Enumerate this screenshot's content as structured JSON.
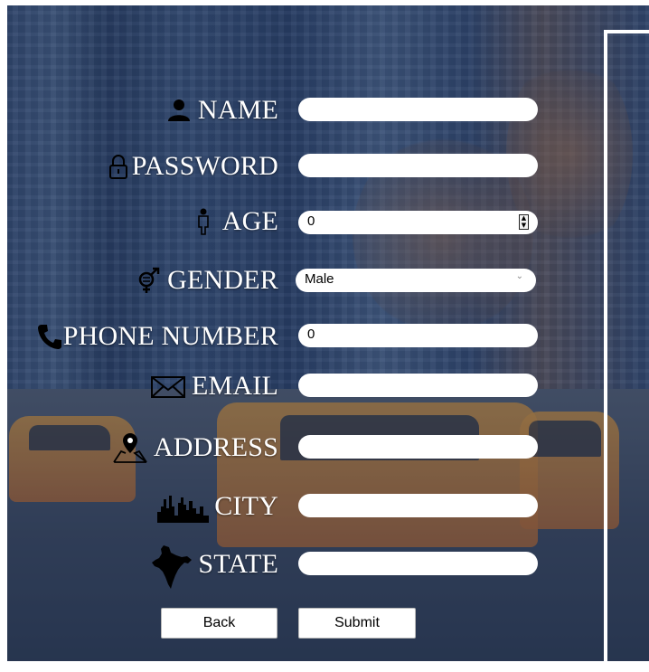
{
  "form": {
    "name_label": "NAME",
    "password_label": "PASSWORD",
    "age_label": "AGE",
    "age_value": "0",
    "gender_label": "GENDER",
    "gender_selected": "Male",
    "phone_label": "PHONE NUMBER",
    "phone_value": "0",
    "email_label": "EMAIL",
    "address_label": "ADDRESS",
    "city_label": "CITY",
    "state_label": "STATE"
  },
  "buttons": {
    "back": "Back",
    "submit": "Submit"
  },
  "icons": {
    "name": "person-icon",
    "password": "padlock-icon",
    "age": "person-standing-icon",
    "gender": "gender-icon",
    "phone": "phone-icon",
    "email": "envelope-icon",
    "address": "map-pin-icon",
    "city": "city-skyline-icon",
    "state": "india-map-icon"
  }
}
